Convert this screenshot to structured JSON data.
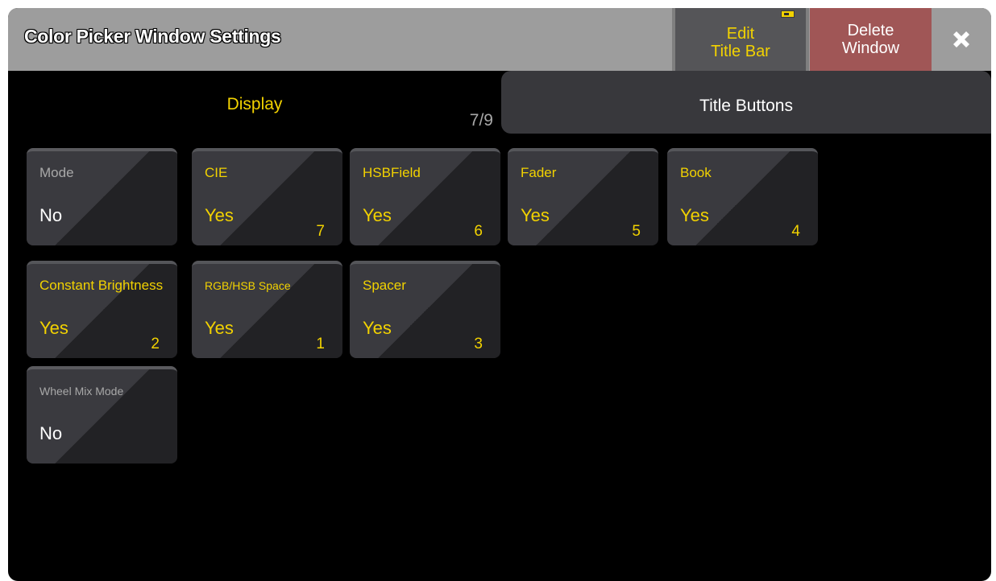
{
  "window": {
    "title": "Color Picker Window Settings",
    "edit_title_bar_line1": "Edit",
    "edit_title_bar_line2": "Title Bar",
    "delete_window_line1": "Delete",
    "delete_window_line2": "Window"
  },
  "tabs": {
    "display": "Display",
    "counter": "7/9",
    "title_buttons": "Title Buttons"
  },
  "tiles": [
    {
      "label": "Mode",
      "value": "No",
      "number": ""
    },
    {
      "label": "CIE",
      "value": "Yes",
      "number": "7"
    },
    {
      "label": "HSBField",
      "value": "Yes",
      "number": "6"
    },
    {
      "label": "Fader",
      "value": "Yes",
      "number": "5"
    },
    {
      "label": "Book",
      "value": "Yes",
      "number": "4"
    },
    {
      "label": "Constant Brightness",
      "value": "Yes",
      "number": "2"
    },
    {
      "label": "RGB/HSB Space",
      "value": "Yes",
      "number": "1"
    },
    {
      "label": "Spacer",
      "value": "Yes",
      "number": "3"
    },
    {
      "label": "Wheel Mix Mode",
      "value": "No",
      "number": ""
    }
  ],
  "colors": {
    "accent": "#f2d200",
    "titlebar": "#9d9d9d",
    "delete": "#a05656",
    "background": "#000000"
  }
}
